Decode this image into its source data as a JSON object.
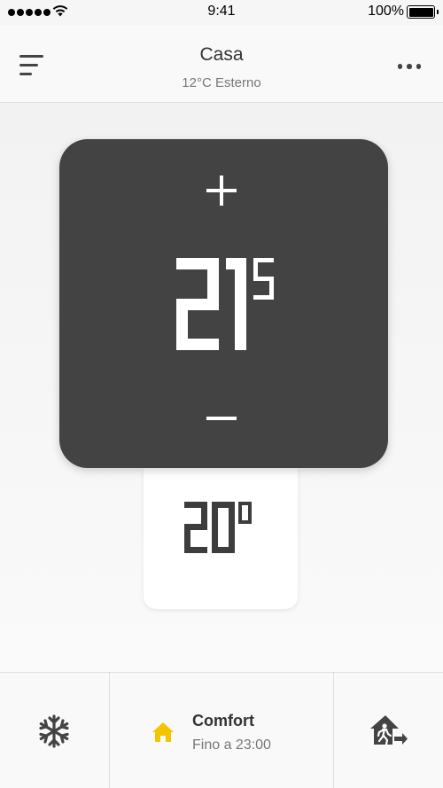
{
  "status_bar": {
    "time": "9:41",
    "battery": "100%",
    "signal_icon": "signal-dots-icon",
    "wifi_icon": "wifi-icon"
  },
  "header": {
    "title": "Casa",
    "subtitle": "12°C Esterno",
    "menu_icon": "menu-icon",
    "more_icon": "more-icon"
  },
  "thermostat": {
    "setpoint_integer": "21",
    "setpoint_fraction": "5",
    "current_temperature": "20",
    "current_unit": "°",
    "increase_icon": "plus-icon",
    "decrease_icon": "minus-icon"
  },
  "bottom_bar": {
    "frost_icon": "snowflake-icon",
    "mode_icon": "home-icon",
    "mode_name": "Comfort",
    "mode_until": "Fino a 23:00",
    "away_icon": "away-house-icon"
  },
  "colors": {
    "screen": "#434343",
    "accent_yellow": "#f5c400",
    "icon_dark": "#444444"
  }
}
